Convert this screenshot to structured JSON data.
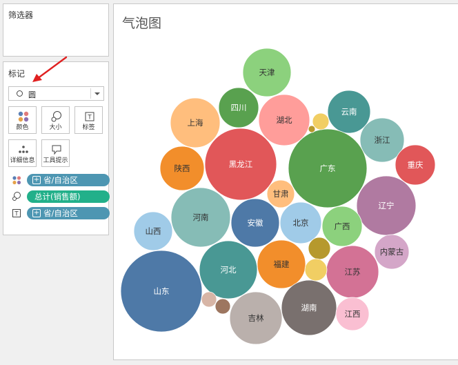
{
  "filters": {
    "title": "筛选器"
  },
  "marks": {
    "title": "标记",
    "mark_type": "圆",
    "buttons": [
      {
        "label": "颜色",
        "icon": "color-dots-icon"
      },
      {
        "label": "大小",
        "icon": "size-icon"
      },
      {
        "label": "标签",
        "icon": "label-icon"
      },
      {
        "label": "详细信息",
        "icon": "detail-dots-icon"
      },
      {
        "label": "工具提示",
        "icon": "tooltip-icon"
      }
    ],
    "pills": [
      {
        "field": "省/自治区",
        "encoding": "color",
        "icon": "color-dots-icon",
        "color": "#4d96b2"
      },
      {
        "field": "总计(销售额)",
        "encoding": "size",
        "icon": "size-icon",
        "color": "#22b08a"
      },
      {
        "field": "省/自治区",
        "encoding": "label",
        "icon": "label-icon",
        "color": "#4d96b2"
      }
    ]
  },
  "viz": {
    "title": "气泡图"
  },
  "chart_data": {
    "type": "bubble",
    "title": "气泡图",
    "size_measure": "总计(销售额)",
    "color_dimension": "省/自治区",
    "bubbles": [
      {
        "label": "天津",
        "value": 1225,
        "color": "#8cd17d"
      },
      {
        "label": "四川",
        "value": 841,
        "color": "#59a14f"
      },
      {
        "label": "湖北",
        "value": 1369,
        "color": "#ff9d9a"
      },
      {
        "label": "云南",
        "value": 961,
        "color": "#499894"
      },
      {
        "label": "上海",
        "value": 1296,
        "color": "#ffbe7d"
      },
      {
        "label": "浙江",
        "value": 1024,
        "color": "#86bcb6"
      },
      {
        "label": "陕西",
        "value": 1024,
        "color": "#f28e2b"
      },
      {
        "label": "黑龙江",
        "value": 2704,
        "color": "#e15759"
      },
      {
        "label": "广东",
        "value": 3249,
        "color": "#59a14f"
      },
      {
        "label": "重庆",
        "value": 841,
        "color": "#e15759"
      },
      {
        "label": "甘肃",
        "value": 400,
        "color": "#ffbe7d"
      },
      {
        "label": "辽宁",
        "value": 1849,
        "color": "#b07aa1"
      },
      {
        "label": "河南",
        "value": 1849,
        "color": "#86bcb6"
      },
      {
        "label": "安徽",
        "value": 1225,
        "color": "#4e79a7"
      },
      {
        "label": "北京",
        "value": 900,
        "color": "#a0cbe8"
      },
      {
        "label": "广西",
        "value": 841,
        "color": "#8cd17d"
      },
      {
        "label": "山西",
        "value": 784,
        "color": "#a0cbe8"
      },
      {
        "label": "内蒙古",
        "value": 625,
        "color": "#d4a6c8"
      },
      {
        "label": "河北",
        "value": 1764,
        "color": "#499894"
      },
      {
        "label": "福建",
        "value": 1225,
        "color": "#f28e2b"
      },
      {
        "label": "江苏",
        "value": 1444,
        "color": "#d37295"
      },
      {
        "label": "山东",
        "value": 3481,
        "color": "#4e79a7"
      },
      {
        "label": "吉林",
        "value": 1444,
        "color": "#bab0ac"
      },
      {
        "label": "湖南",
        "value": 1600,
        "color": "#79706e"
      },
      {
        "label": "江西",
        "value": 576,
        "color": "#fabfd2"
      },
      {
        "label": "",
        "value": 144,
        "color": "#f1ce63"
      },
      {
        "label": "",
        "value": 25,
        "color": "#b6992d"
      },
      {
        "label": "",
        "value": 256,
        "color": "#b6992d"
      },
      {
        "label": "",
        "value": 256,
        "color": "#f1ce63"
      },
      {
        "label": "",
        "value": 121,
        "color": "#d7b5a6"
      },
      {
        "label": "",
        "value": 121,
        "color": "#9d7660"
      }
    ]
  }
}
